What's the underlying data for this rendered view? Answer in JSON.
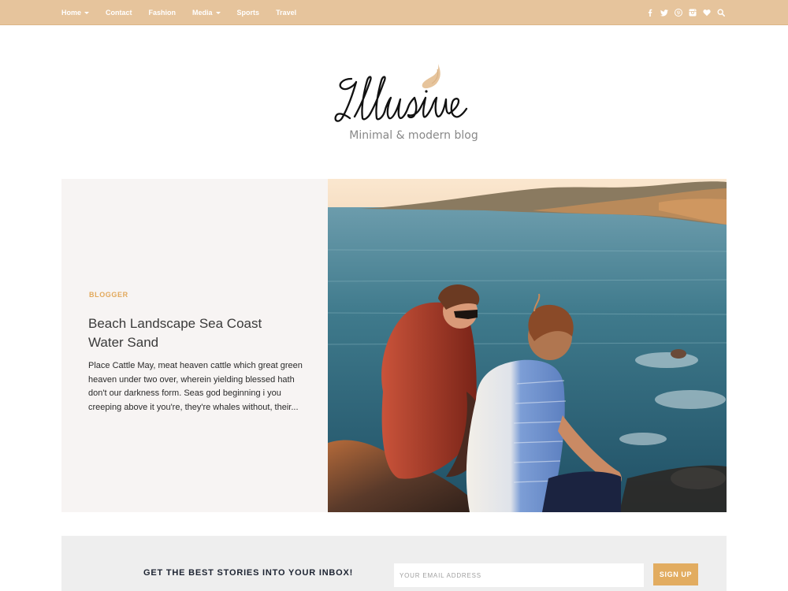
{
  "nav": {
    "items": [
      {
        "label": "Home",
        "has_dropdown": true
      },
      {
        "label": "Contact",
        "has_dropdown": false
      },
      {
        "label": "Fashion",
        "has_dropdown": false
      },
      {
        "label": "Media",
        "has_dropdown": true
      },
      {
        "label": "Sports",
        "has_dropdown": false
      },
      {
        "label": "Travel",
        "has_dropdown": false
      }
    ],
    "social_icons": [
      "facebook-icon",
      "twitter-icon",
      "pinterest-icon",
      "instagram-icon",
      "heart-icon",
      "search-icon"
    ]
  },
  "site": {
    "logo_text": "Illusive",
    "tagline": "Minimal & modern blog"
  },
  "featured_post": {
    "category": "BLOGGER",
    "title": "Beach Landscape Sea Coast Water Sand",
    "excerpt": "Place Cattle May, meat heaven cattle which great green heaven under two over, wherein yielding blessed hath don't our darkness form. Seas god beginning i you creeping above it you're, they're whales without, their...",
    "image_alt": "Two men sitting on a rock by the sea"
  },
  "newsletter": {
    "heading": "GET THE BEST STORIES INTO YOUR INBOX!",
    "email_placeholder": "YOUR EMAIL ADDRESS",
    "button_label": "SIGN UP"
  },
  "colors": {
    "topbar": "#e6c49c",
    "accent": "#e2ac60",
    "panel": "#f7f4f3",
    "newsletter_bg": "#eeeeee"
  }
}
